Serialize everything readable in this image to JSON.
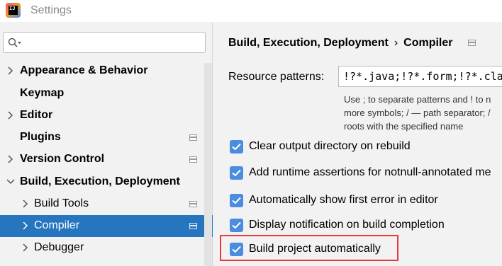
{
  "window": {
    "title": "Settings",
    "app_icon_text": "IJ"
  },
  "search": {
    "placeholder": ""
  },
  "sidebar": {
    "items": [
      {
        "label": "Appearance & Behavior",
        "expandable": true,
        "expanded": false
      },
      {
        "label": "Keymap",
        "expandable": false
      },
      {
        "label": "Editor",
        "expandable": true,
        "expanded": false
      },
      {
        "label": "Plugins",
        "expandable": false,
        "icon": "project-settings-icon"
      },
      {
        "label": "Version Control",
        "expandable": true,
        "expanded": false,
        "icon": "project-settings-icon"
      },
      {
        "label": "Build, Execution, Deployment",
        "expandable": true,
        "expanded": true
      },
      {
        "label": "Build Tools",
        "expandable": true,
        "expanded": false,
        "icon": "project-settings-icon"
      },
      {
        "label": "Compiler",
        "expandable": true,
        "expanded": false,
        "selected": true,
        "icon": "project-settings-icon"
      },
      {
        "label": "Debugger",
        "expandable": true,
        "expanded": false
      }
    ]
  },
  "breadcrumb": {
    "parent": "Build, Execution, Deployment",
    "separator": "›",
    "current": "Compiler"
  },
  "resource": {
    "label": "Resource patterns:",
    "value": "!?*.java;!?*.form;!?*.class",
    "hint_lines": [
      "Use ; to separate patterns and ! to n",
      "more symbols; / — path separator; /",
      "roots with the specified name"
    ]
  },
  "options": [
    {
      "label": "Clear output directory on rebuild",
      "checked": true
    },
    {
      "label": "Add runtime assertions for notnull-annotated me",
      "checked": true
    },
    {
      "label": "Automatically show first error in editor",
      "checked": true
    },
    {
      "label": "Display notification on build completion",
      "checked": true
    },
    {
      "label": "Build project automatically",
      "checked": true,
      "highlighted": true
    }
  ],
  "colors": {
    "selection": "#2675bf",
    "checkbox": "#4a8ce0",
    "highlight_border": "#e5393b"
  }
}
